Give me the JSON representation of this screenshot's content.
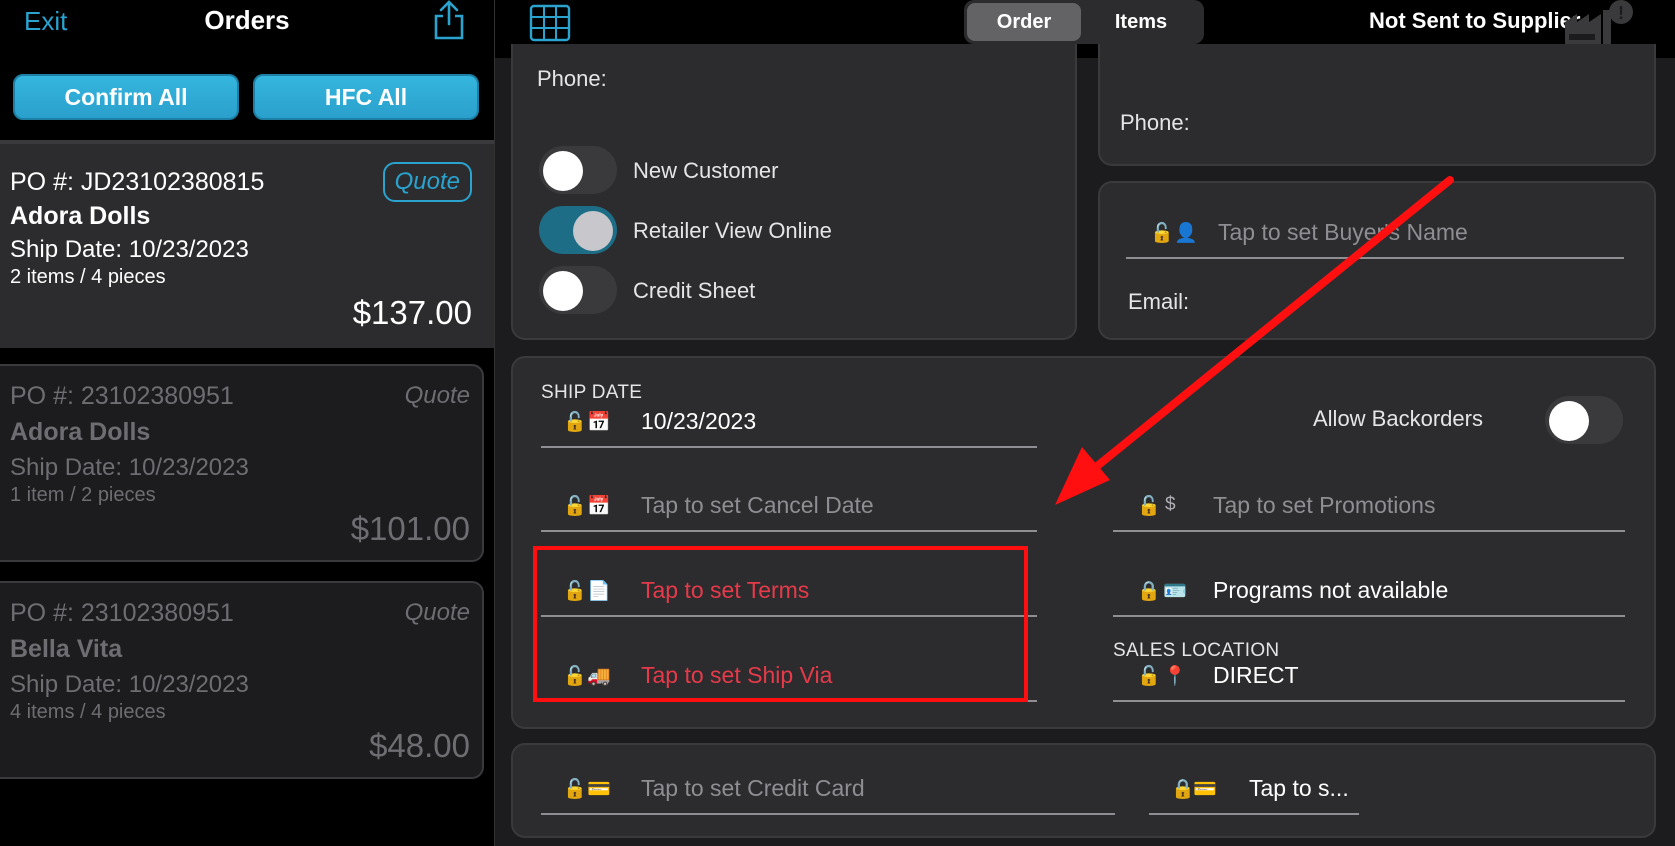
{
  "sidebar": {
    "exit_label": "Exit",
    "title": "Orders",
    "share_icon": "share-icon",
    "confirm_all_label": "Confirm All",
    "hfc_all_label": "HFC All",
    "orders": [
      {
        "po": "PO #: JD23102380815",
        "badge": "Quote",
        "customer": "Adora Dolls",
        "ship_date": "Ship Date: 10/23/2023",
        "items": "2 items / 4 pieces",
        "total": "$137.00"
      },
      {
        "po": "PO #: 23102380951",
        "badge": "Quote",
        "customer": "Adora Dolls",
        "ship_date": "Ship Date: 10/23/2023",
        "items": "1 item / 2 pieces",
        "total": "$101.00"
      },
      {
        "po": "PO #: 23102380951",
        "badge": "Quote",
        "customer": "Bella Vita",
        "ship_date": "Ship Date: 10/23/2023",
        "items": "4 items / 4 pieces",
        "total": "$48.00"
      }
    ]
  },
  "topbar": {
    "segments": [
      "Order",
      "Items"
    ],
    "selected_segment": "Order",
    "status": "Not Sent to Supplier"
  },
  "customer_panel": {
    "phone_label": "Phone:",
    "toggles": [
      {
        "label": "New Customer",
        "on": false
      },
      {
        "label": "Retailer View Online",
        "on": true
      },
      {
        "label": "Credit Sheet",
        "on": false
      }
    ]
  },
  "supplier_panel": {
    "phone_label": "Phone:",
    "buyer_placeholder": "Tap to set Buyer's Name",
    "email_label": "Email:"
  },
  "order_details": {
    "ship_date_heading": "SHIP DATE",
    "ship_date_value": "10/23/2023",
    "allow_backorders_label": "Allow Backorders",
    "allow_backorders_on": false,
    "cancel_date_placeholder": "Tap to set Cancel Date",
    "terms_placeholder": "Tap to set Terms",
    "ship_via_placeholder": "Tap to set Ship Via",
    "promotions_placeholder": "Tap to set Promotions",
    "programs_text": "Programs not available",
    "sales_location_heading": "SALES LOCATION",
    "sales_location_value": "DIRECT"
  },
  "payment_panel": {
    "credit_card_placeholder": "Tap to set Credit Card",
    "second_placeholder": "Tap to s..."
  },
  "colors": {
    "accent": "#2aa3cf",
    "highlight": "#ff0f10",
    "warning_text": "#e63a4a"
  }
}
